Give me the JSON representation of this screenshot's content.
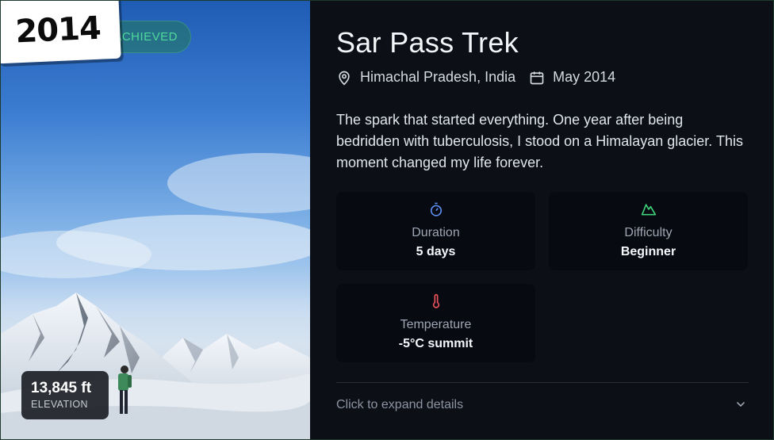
{
  "trek": {
    "year": "2014",
    "status_badge": "ACHIEVED",
    "title": "Sar Pass Trek",
    "location": "Himachal Pradesh, India",
    "date": "May 2014",
    "description": "The spark that started everything. One year after being bedridden with tuberculosis, I stood on a Himalayan glacier. This moment changed my life forever.",
    "elevation": {
      "value": "13,845 ft",
      "label": "ELEVATION"
    }
  },
  "stats": [
    {
      "icon": "stopwatch-icon",
      "label": "Duration",
      "value": "5 days",
      "color": "#5b8def"
    },
    {
      "icon": "mountain-icon",
      "label": "Difficulty",
      "value": "Beginner",
      "color": "#3ecf7a"
    },
    {
      "icon": "thermometer-icon",
      "label": "Temperature",
      "value": "-5°C summit",
      "color": "#e9525a"
    }
  ],
  "footer": {
    "expand_label": "Click to expand details"
  },
  "colors": {
    "accent_green": "#4fd89a",
    "background": "#0c0f16",
    "stat_bg": "#070a10"
  }
}
